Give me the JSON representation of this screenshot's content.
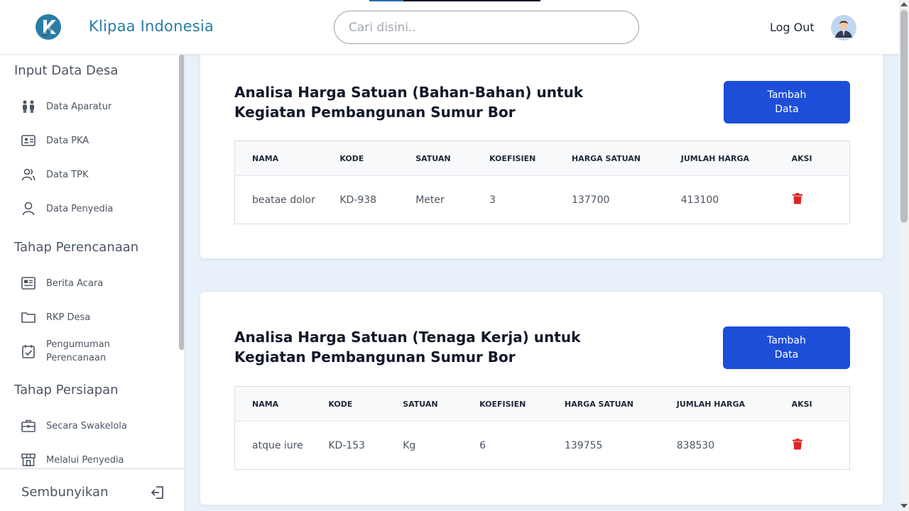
{
  "header": {
    "app_title": "Klipaa Indonesia",
    "search_placeholder": "Cari disini..",
    "logout_label": "Log Out",
    "progress": 0.2
  },
  "sidebar": {
    "sections": [
      {
        "title": "Input Data Desa",
        "items": [
          {
            "label": "Data Aparatur",
            "icon": "people-icon"
          },
          {
            "label": "Data PKA",
            "icon": "id-card-icon"
          },
          {
            "label": "Data TPK",
            "icon": "users-icon"
          },
          {
            "label": "Data Penyedia",
            "icon": "user-icon"
          }
        ]
      },
      {
        "title": "Tahap Perencanaan",
        "items": [
          {
            "label": "Berita Acara",
            "icon": "newspaper-icon"
          },
          {
            "label": "RKP Desa",
            "icon": "folder-icon"
          },
          {
            "label": "Pengumuman Perencanaan",
            "icon": "calendar-check-icon"
          }
        ]
      },
      {
        "title": "Tahap Persiapan",
        "items": [
          {
            "label": "Secara Swakelola",
            "icon": "briefcase-icon"
          },
          {
            "label": "Melalui Penyedia",
            "icon": "store-icon"
          }
        ]
      }
    ],
    "footer_label": "Sembunyikan"
  },
  "cards": [
    {
      "title": "Analisa Harga Satuan (Bahan-Bahan) untuk Kegiatan Pembangunan Sumur Bor",
      "button_label": "Tambah Data",
      "columns": [
        "NAMA",
        "KODE",
        "SATUAN",
        "KOEFISIEN",
        "HARGA SATUAN",
        "JUMLAH HARGA",
        "AKSI"
      ],
      "rows": [
        {
          "nama": "beatae dolor",
          "kode": "KD-938",
          "satuan": "Meter",
          "koefisien": "3",
          "harga_satuan": "137700",
          "jumlah_harga": "413100"
        }
      ]
    },
    {
      "title": "Analisa Harga Satuan (Tenaga Kerja) untuk Kegiatan Pembangunan Sumur Bor",
      "button_label": "Tambah Data",
      "columns": [
        "NAMA",
        "KODE",
        "SATUAN",
        "KOEFISIEN",
        "HARGA SATUAN",
        "JUMLAH HARGA",
        "AKSI"
      ],
      "rows": [
        {
          "nama": "atque iure",
          "kode": "KD-153",
          "satuan": "Kg",
          "koefisien": "6",
          "harga_satuan": "139755",
          "jumlah_harga": "838530"
        }
      ]
    }
  ],
  "colors": {
    "brand": "#2a7da6",
    "primary_button": "#1d4ed8",
    "delete": "#dc2626",
    "background": "#e8f0fa"
  }
}
